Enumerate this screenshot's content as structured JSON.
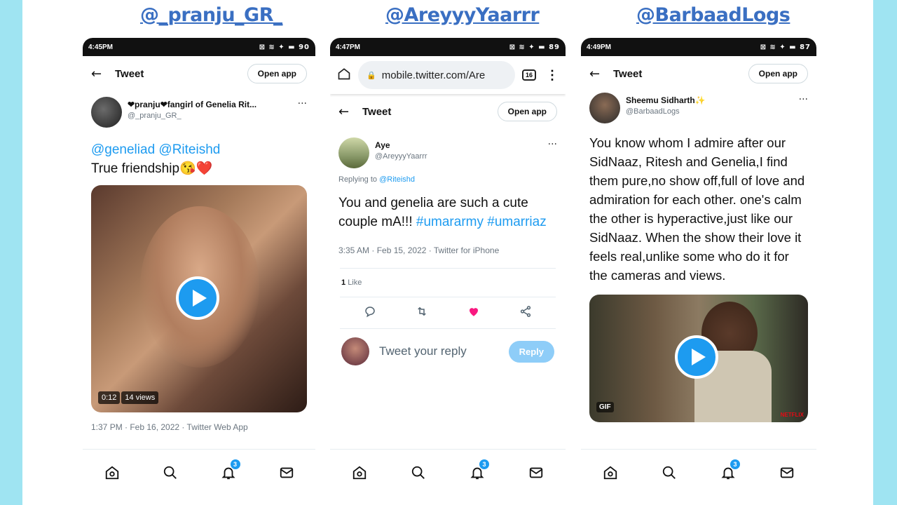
{
  "handles": [
    "@_pranju_GR_",
    "@AreyyyYaarrr",
    "@BarbaadLogs"
  ],
  "common": {
    "tweet_title": "Tweet",
    "open_app": "Open app",
    "more": "···",
    "back": "←"
  },
  "phone1": {
    "time": "4:45PM",
    "status_icons": "⊠ ≋ ✦ ▬ 90",
    "display_name": "❤pranju❤fangirl of Genelia Rit...",
    "username": "@_pranju_GR_",
    "mention": "@geneliad @Riteishd",
    "text": "True friendship😘❤️",
    "video_time": "0:12",
    "video_views": "14 views",
    "meta": "1:37 PM · Feb 16, 2022 · Twitter Web App"
  },
  "phone2": {
    "time": "4:47PM",
    "status_icons": "⊠ ≋ ✦ ▬ 89",
    "url": "mobile.twitter.com/Are",
    "tabs_count": "16",
    "display_name": "Aye",
    "username": "@AreyyyYaarrr",
    "replying_prefix": "Replying to ",
    "replying_to": "@Riteishd",
    "text": "You and genelia are such a cute couple mA!!!",
    "hashtag1": "#umararmy",
    "hashtag2": "#umarriaz",
    "meta": "3:35 AM · Feb 15, 2022 · Twitter for iPhone",
    "likes_count": "1",
    "likes_label": "Like",
    "reply_placeholder": "Tweet your reply",
    "reply_button": "Reply"
  },
  "phone3": {
    "time": "4:49PM",
    "status_icons": "⊠ ≋ ✦ ▬ 87",
    "display_name": "Sheemu Sidharth✨",
    "username": "@BarbaadLogs",
    "text": "You know whom I admire after our SidNaaz, Ritesh and Genelia,I find them pure,no show off,full of love and admiration for each other. one's calm the other is hyperactive,just like our SidNaaz. When the show their love it feels real,unlike some who do it for the cameras and views.",
    "gif_label": "GIF",
    "netflix_label": "NETFLIX"
  },
  "nav": {
    "badge": "3",
    "icons": [
      "home-icon",
      "search-icon",
      "bell-icon",
      "mail-icon"
    ]
  },
  "colors": {
    "accent": "#1d9bf0",
    "background": "#9fe4f2",
    "handle": "#3a6fc2",
    "like": "#f91880"
  }
}
